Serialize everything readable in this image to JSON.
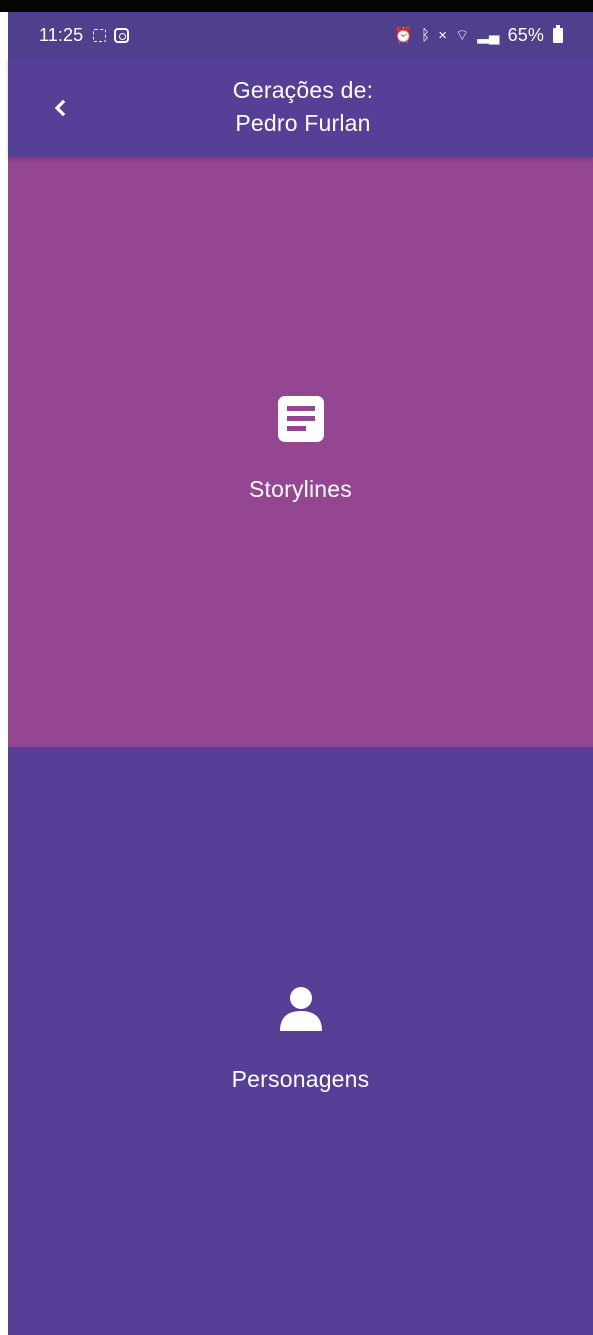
{
  "status_bar": {
    "time": "11:25",
    "battery": "65%",
    "icons": [
      "screen-capture-icon",
      "instagram-icon",
      "alarm-icon",
      "bluetooth-icon",
      "mute-icon",
      "wifi-icon",
      "signal-icon",
      "battery-icon"
    ]
  },
  "header": {
    "back_icon": "chevron-left-icon",
    "title_line_1": "Gerações de:",
    "title_line_2": "Pedro Furlan",
    "background": "#563f96"
  },
  "sections": [
    {
      "label": "Storylines",
      "icon": "document-icon",
      "background": "#944693"
    },
    {
      "label": "Personagens",
      "icon": "person-icon",
      "background": "#563f96"
    }
  ],
  "colors": {
    "status_bar": "#503f8d",
    "text": "#ffffff"
  }
}
